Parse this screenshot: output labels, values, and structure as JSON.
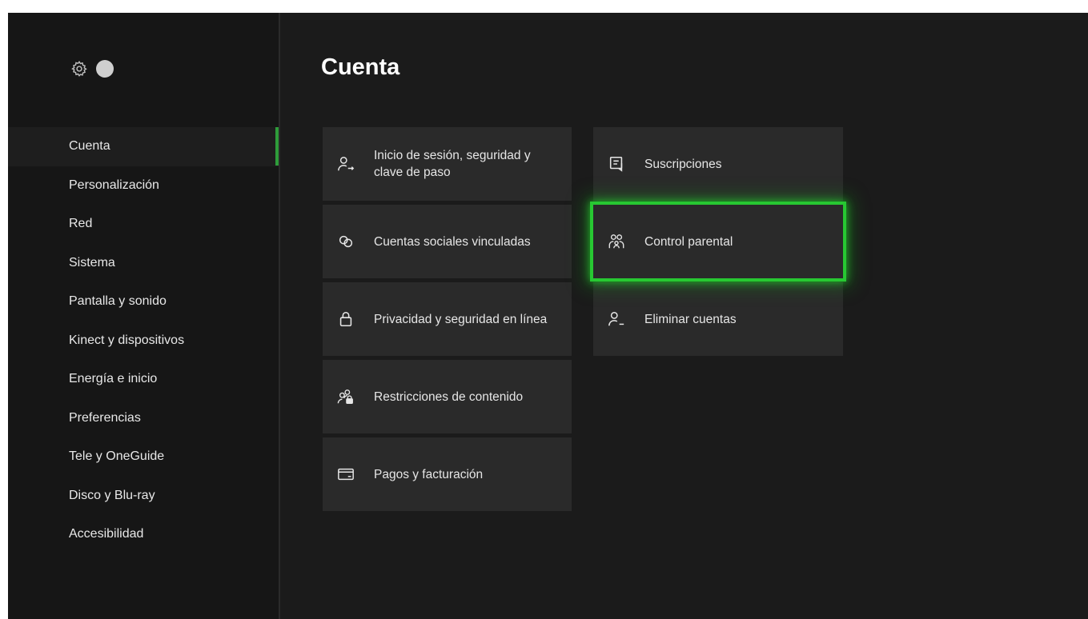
{
  "sidebar": {
    "icons": {
      "settings": "gear-icon",
      "profile": "avatar"
    },
    "items": [
      {
        "label": "Cuenta",
        "active": true
      },
      {
        "label": "Personalización",
        "active": false
      },
      {
        "label": "Red",
        "active": false
      },
      {
        "label": "Sistema",
        "active": false
      },
      {
        "label": "Pantalla y sonido",
        "active": false
      },
      {
        "label": "Kinect y dispositivos",
        "active": false
      },
      {
        "label": "Energía e inicio",
        "active": false
      },
      {
        "label": "Preferencias",
        "active": false
      },
      {
        "label": "Tele y OneGuide",
        "active": false
      },
      {
        "label": "Disco y Blu-ray",
        "active": false
      },
      {
        "label": "Accesibilidad",
        "active": false
      }
    ]
  },
  "main": {
    "title": "Cuenta",
    "tiles_left": [
      {
        "label": "Inicio de sesión, seguridad y clave de paso",
        "icon": "person-key-icon"
      },
      {
        "label": "Cuentas sociales vinculadas",
        "icon": "linked-rings-icon"
      },
      {
        "label": "Privacidad y seguridad en línea",
        "icon": "lock-icon"
      },
      {
        "label": "Restricciones de contenido",
        "icon": "people-lock-icon"
      },
      {
        "label": "Pagos y facturación",
        "icon": "credit-card-icon"
      }
    ],
    "tiles_right": [
      {
        "label": "Suscripciones",
        "icon": "subscription-icon"
      },
      {
        "label": "Control parental",
        "icon": "family-icon",
        "focused": true
      },
      {
        "label": "Eliminar cuentas",
        "icon": "person-remove-icon"
      }
    ]
  },
  "colors": {
    "accent": "#2e9c3a",
    "focus": "#27c832",
    "background": "#1b1b1b",
    "tile": "#2a2a2a"
  }
}
